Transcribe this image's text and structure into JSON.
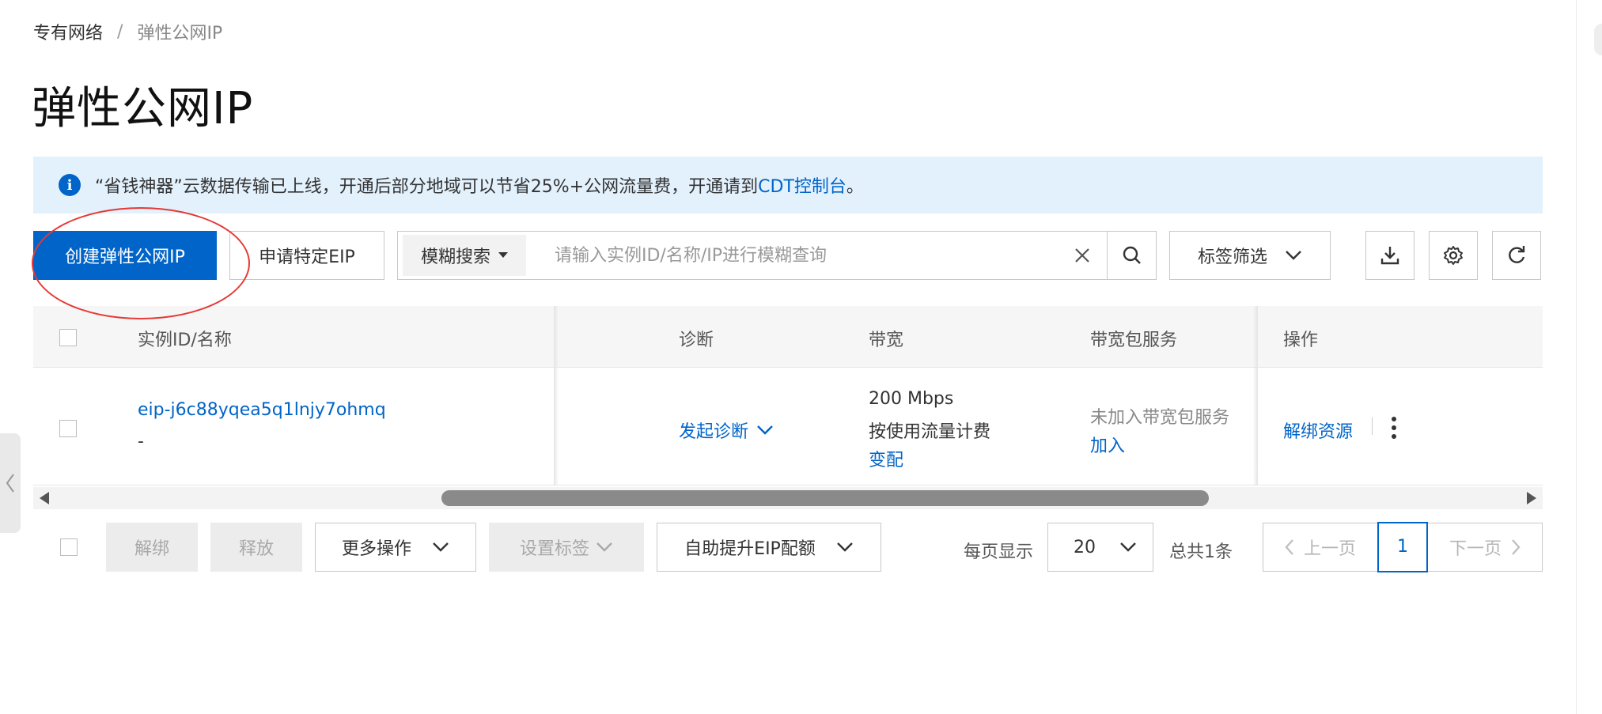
{
  "breadcrumb": {
    "parent": "专有网络",
    "separator": "/",
    "current": "弹性公网IP"
  },
  "page_title": "弹性公网IP",
  "notice": {
    "text": "“省钱神器”云数据传输已上线，开通后部分地域可以节省25%+公网流量费，开通请到",
    "link": "CDT控制台",
    "suffix": "。"
  },
  "toolbar": {
    "create_label": "创建弹性公网IP",
    "apply_label": "申请特定EIP",
    "search_type": "模糊搜索",
    "search_placeholder": "请输入实例ID/名称/IP进行模糊查询",
    "tag_filter_label": "标签筛选",
    "icons": [
      "download-icon",
      "gear-icon",
      "refresh-icon"
    ]
  },
  "table": {
    "columns": [
      "实例ID/名称",
      "诊断",
      "带宽",
      "带宽包服务",
      "操作"
    ],
    "rows": [
      {
        "instance_id": "eip-j6c88yqea5q1lnjy7ohmq",
        "name": "-",
        "diagnose": "发起诊断",
        "bandwidth": "200 Mbps",
        "billing": "按使用流量计费",
        "change": "变配",
        "package_status": "未加入带宽包服务",
        "package_join": "加入",
        "unbind": "解绑资源"
      }
    ]
  },
  "footer": {
    "unbind": "解绑",
    "release": "释放",
    "more_ops": "更多操作",
    "set_tags": "设置标签",
    "quota": "自助提升EIP配额",
    "page_size_label": "每页显示",
    "page_size": "20",
    "total": "总共1条",
    "prev": "上一页",
    "page": "1",
    "next": "下一页"
  },
  "colors": {
    "primary": "#0064c8",
    "notice_bg": "#e3f1fd",
    "annotation": "#e53935"
  }
}
